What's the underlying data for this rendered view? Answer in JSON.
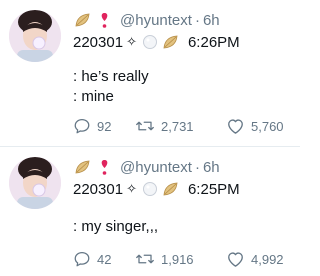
{
  "tweets": [
    {
      "handle": "@hyuntext",
      "time": "6h",
      "code": "220301",
      "sparkle": "✧",
      "tweet_time": "6:26PM",
      "lines": [
        ": he’s really",
        ": mine"
      ],
      "replies": "92",
      "retweets": "2,731",
      "likes": "5,760"
    },
    {
      "handle": "@hyuntext",
      "time": "6h",
      "code": "220301",
      "sparkle": "✧",
      "tweet_time": "6:25PM",
      "lines": [
        ": my singer,,,"
      ],
      "replies": "42",
      "retweets": "1,916",
      "likes": "4,992"
    }
  ],
  "colors": {
    "muted": "#657786",
    "heart_emoji": "#e0245e",
    "leaf_emoji": "#d9b36c"
  },
  "icons": [
    "leaf-emoji-icon",
    "heart-emoji-icon",
    "bubble-emoji-icon",
    "reply-icon",
    "retweet-icon",
    "like-icon"
  ]
}
